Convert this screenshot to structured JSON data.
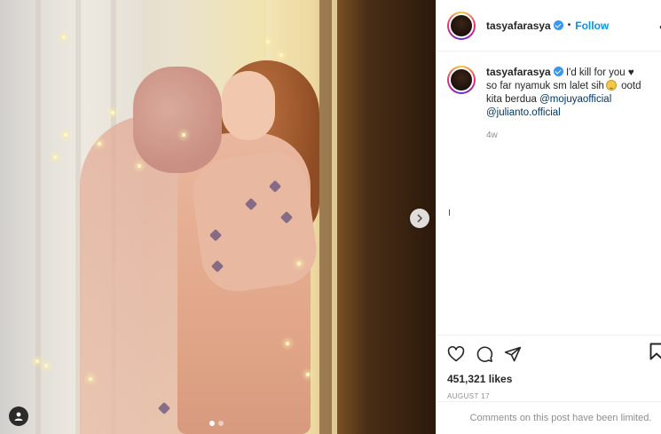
{
  "post": {
    "author": {
      "username": "tasyafarasya",
      "verified": true,
      "follow_label": "Follow",
      "separator": "•"
    },
    "media": {
      "carousel_dots": 2,
      "active_dot": 0,
      "next_icon": "chevron-right-icon",
      "tag_icon": "user-tag-icon"
    },
    "caption": {
      "username": "tasyafarasya",
      "text_part1": "I'd kill for you ",
      "heart": "♥",
      "text_part2": " so far nyamuk sm lalet sih",
      "emoji": "smiling-face-emoji",
      "text_part3": " ootd kita berdua ",
      "mention1": "@mojuyaofficial",
      "mention2": "@julianto.official",
      "time_ago": "4w"
    },
    "actions": {
      "icons": [
        "heart-icon",
        "comment-icon",
        "share-icon",
        "bookmark-icon"
      ],
      "likes": "451,321 likes",
      "date": "AUGUST 17"
    },
    "comments_notice": "Comments on this post have been limited."
  },
  "colors": {
    "follow_blue": "#0095f6",
    "verified_blue": "#3897f0",
    "muted_text": "#8e8e8e",
    "mention_text": "#00376b"
  }
}
